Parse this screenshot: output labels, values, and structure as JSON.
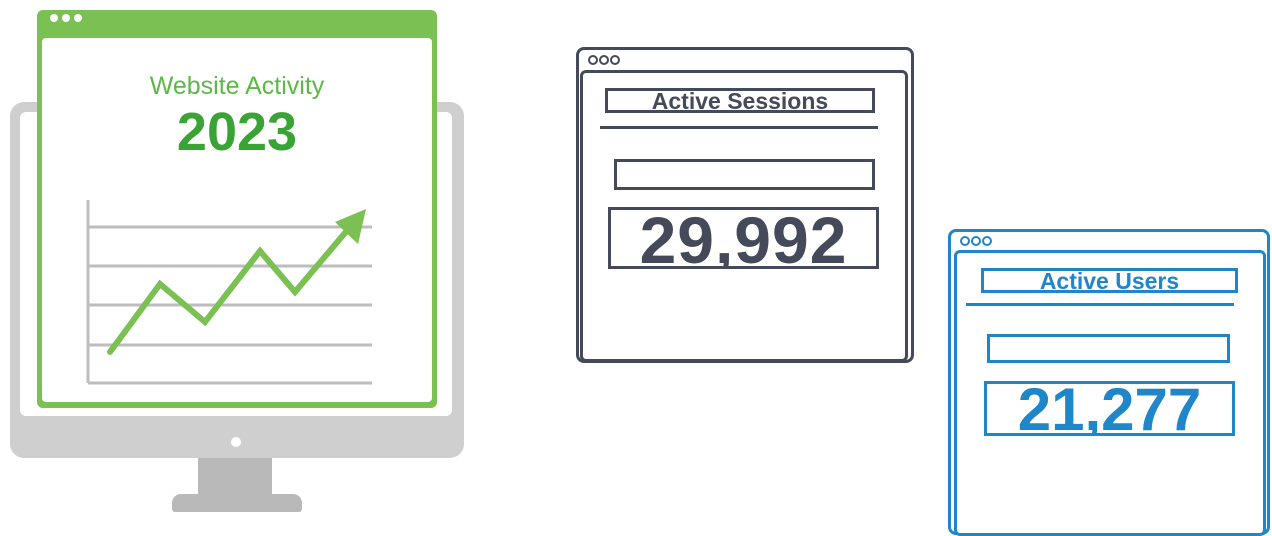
{
  "website_card": {
    "title": "Website Activity",
    "year": "2023",
    "accent_color": "#7bc052",
    "title_color": "#5cb847",
    "year_color": "#3aa335",
    "trend_icon": "trend-up-arrow-icon"
  },
  "sessions_window": {
    "title": "Active Sessions",
    "value": "29,992",
    "color": "#444a5a"
  },
  "users_window": {
    "title": "Active Users",
    "value": "21,277",
    "color": "#1f86c9"
  },
  "monitor": {
    "icon": "desktop-monitor-icon",
    "color": "#cfcfcf"
  }
}
